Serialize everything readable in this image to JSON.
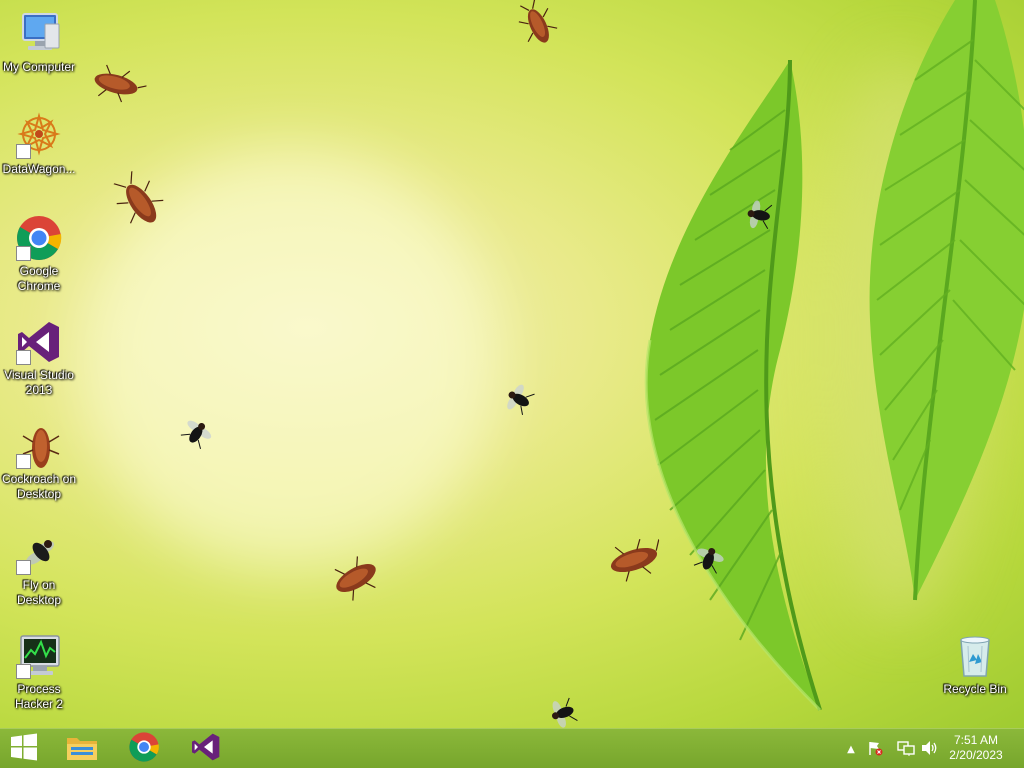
{
  "desktop": {
    "icons": [
      {
        "label": "My Computer",
        "icon": "computer-icon"
      },
      {
        "label": "DataWagon...",
        "icon": "datawagon-icon"
      },
      {
        "label": "Google Chrome",
        "icon": "chrome-icon"
      },
      {
        "label": "Visual Studio 2013",
        "icon": "visual-studio-icon"
      },
      {
        "label": "Cockroach on Desktop",
        "icon": "cockroach-icon"
      },
      {
        "label": "Fly on Desktop",
        "icon": "fly-icon"
      },
      {
        "label": "Process Hacker 2",
        "icon": "process-hacker-icon"
      }
    ],
    "recycle_bin": {
      "label": "Recycle Bin",
      "icon": "recycle-bin-icon"
    }
  },
  "taskbar": {
    "start": {
      "icon": "windows-start-icon"
    },
    "pinned": [
      {
        "icon": "file-explorer-icon"
      },
      {
        "icon": "chrome-icon"
      },
      {
        "icon": "visual-studio-icon"
      }
    ],
    "tray": {
      "show_hidden": "▲",
      "icons": [
        "action-center-flag-icon",
        "network-icon",
        "volume-icon"
      ]
    },
    "clock": {
      "time": "7:51 AM",
      "date": "2/20/2023"
    }
  },
  "colors": {
    "taskbar": "#80b034",
    "wallpaper_light": "#f3f1b8",
    "wallpaper_green": "#9fcb31",
    "leaf": "#6cc026"
  }
}
